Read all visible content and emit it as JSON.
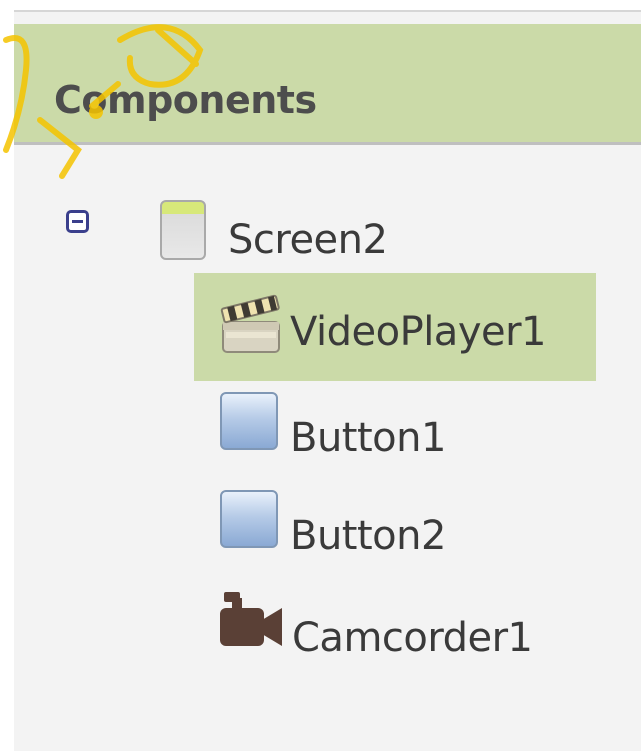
{
  "panel": {
    "title": "Components"
  },
  "tree": {
    "root": {
      "label": "Screen2",
      "icon": "screen-icon",
      "collapse_icon": "collapse-icon"
    },
    "children": [
      {
        "label": "VideoPlayer1",
        "icon": "videoplayer-icon",
        "selected": true
      },
      {
        "label": "Button1",
        "icon": "button-icon",
        "selected": false
      },
      {
        "label": "Button2",
        "icon": "button-icon",
        "selected": false
      },
      {
        "label": "Camcorder1",
        "icon": "camcorder-icon",
        "selected": false
      }
    ]
  },
  "colors": {
    "header_bg": "#cbdaa8",
    "selected_bg": "#cbdaa8",
    "panel_bg": "#f3f3f3",
    "collapse_icon": "#3a3f8c",
    "watermark": "#f5c400"
  }
}
